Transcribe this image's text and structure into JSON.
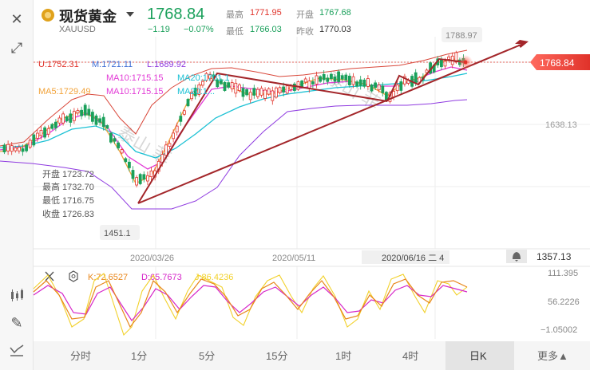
{
  "header": {
    "title": "现货黄金",
    "code": "XAUUSD",
    "price": "1768.84",
    "change": "−1.19",
    "change_pct": "−0.07%",
    "high_label": "最高",
    "high_value": "1771.95",
    "open_label": "开盘",
    "open_value": "1767.68",
    "low_label": "最低",
    "low_value": "1766.03",
    "prev_label": "昨收",
    "prev_value": "1770.03"
  },
  "indicators": {
    "bollinger": {
      "u": "U:1752.31",
      "m": "M:1721.11",
      "l": "L:1689.92"
    },
    "ma10_a": "MA10:1715.15",
    "ma20_a": "MA20:1701.1",
    "ma5": "MA5:1729.49",
    "ma10_b": "MA10:1715.15",
    "ma20_b": "MA20:1..."
  },
  "ohlc_tooltip": {
    "open": "开盘 1723.72",
    "high": "最高 1732.70",
    "low": "最低 1716.75",
    "close": "收盘 1726.83"
  },
  "price_axis": {
    "current": "1768.84",
    "marks": [
      "1788.97",
      "1638.13",
      "1451.1",
      "1357.13"
    ]
  },
  "date_axis": [
    "2020/03/26",
    "2020/05/11",
    "2020/06/16 二 4"
  ],
  "kdj": {
    "k": "K:72.6527",
    "d": "D:65.7673",
    "j": "J:86.4236"
  },
  "kdj_axis": [
    "111.395",
    "56.2226",
    "−1.05002"
  ],
  "watermark": "泰山 菲",
  "timeframes": [
    {
      "label": "分时",
      "active": false
    },
    {
      "label": "1分",
      "active": false
    },
    {
      "label": "5分",
      "active": false
    },
    {
      "label": "15分",
      "active": false
    },
    {
      "label": "1时",
      "active": false
    },
    {
      "label": "4时",
      "active": false
    },
    {
      "label": "日K",
      "active": true
    },
    {
      "label": "更多▲",
      "active": false
    }
  ],
  "colors": {
    "up": "#e0322a",
    "down": "#1aa05b",
    "ma5": "#f2a33a",
    "ma10": "#e23ad6",
    "ma20": "#1cc1d4",
    "boll_outer": "#8f3be0",
    "trend": "#a3262a",
    "k": "#e8861a",
    "d": "#d626c9",
    "j": "#f2d12b"
  }
}
